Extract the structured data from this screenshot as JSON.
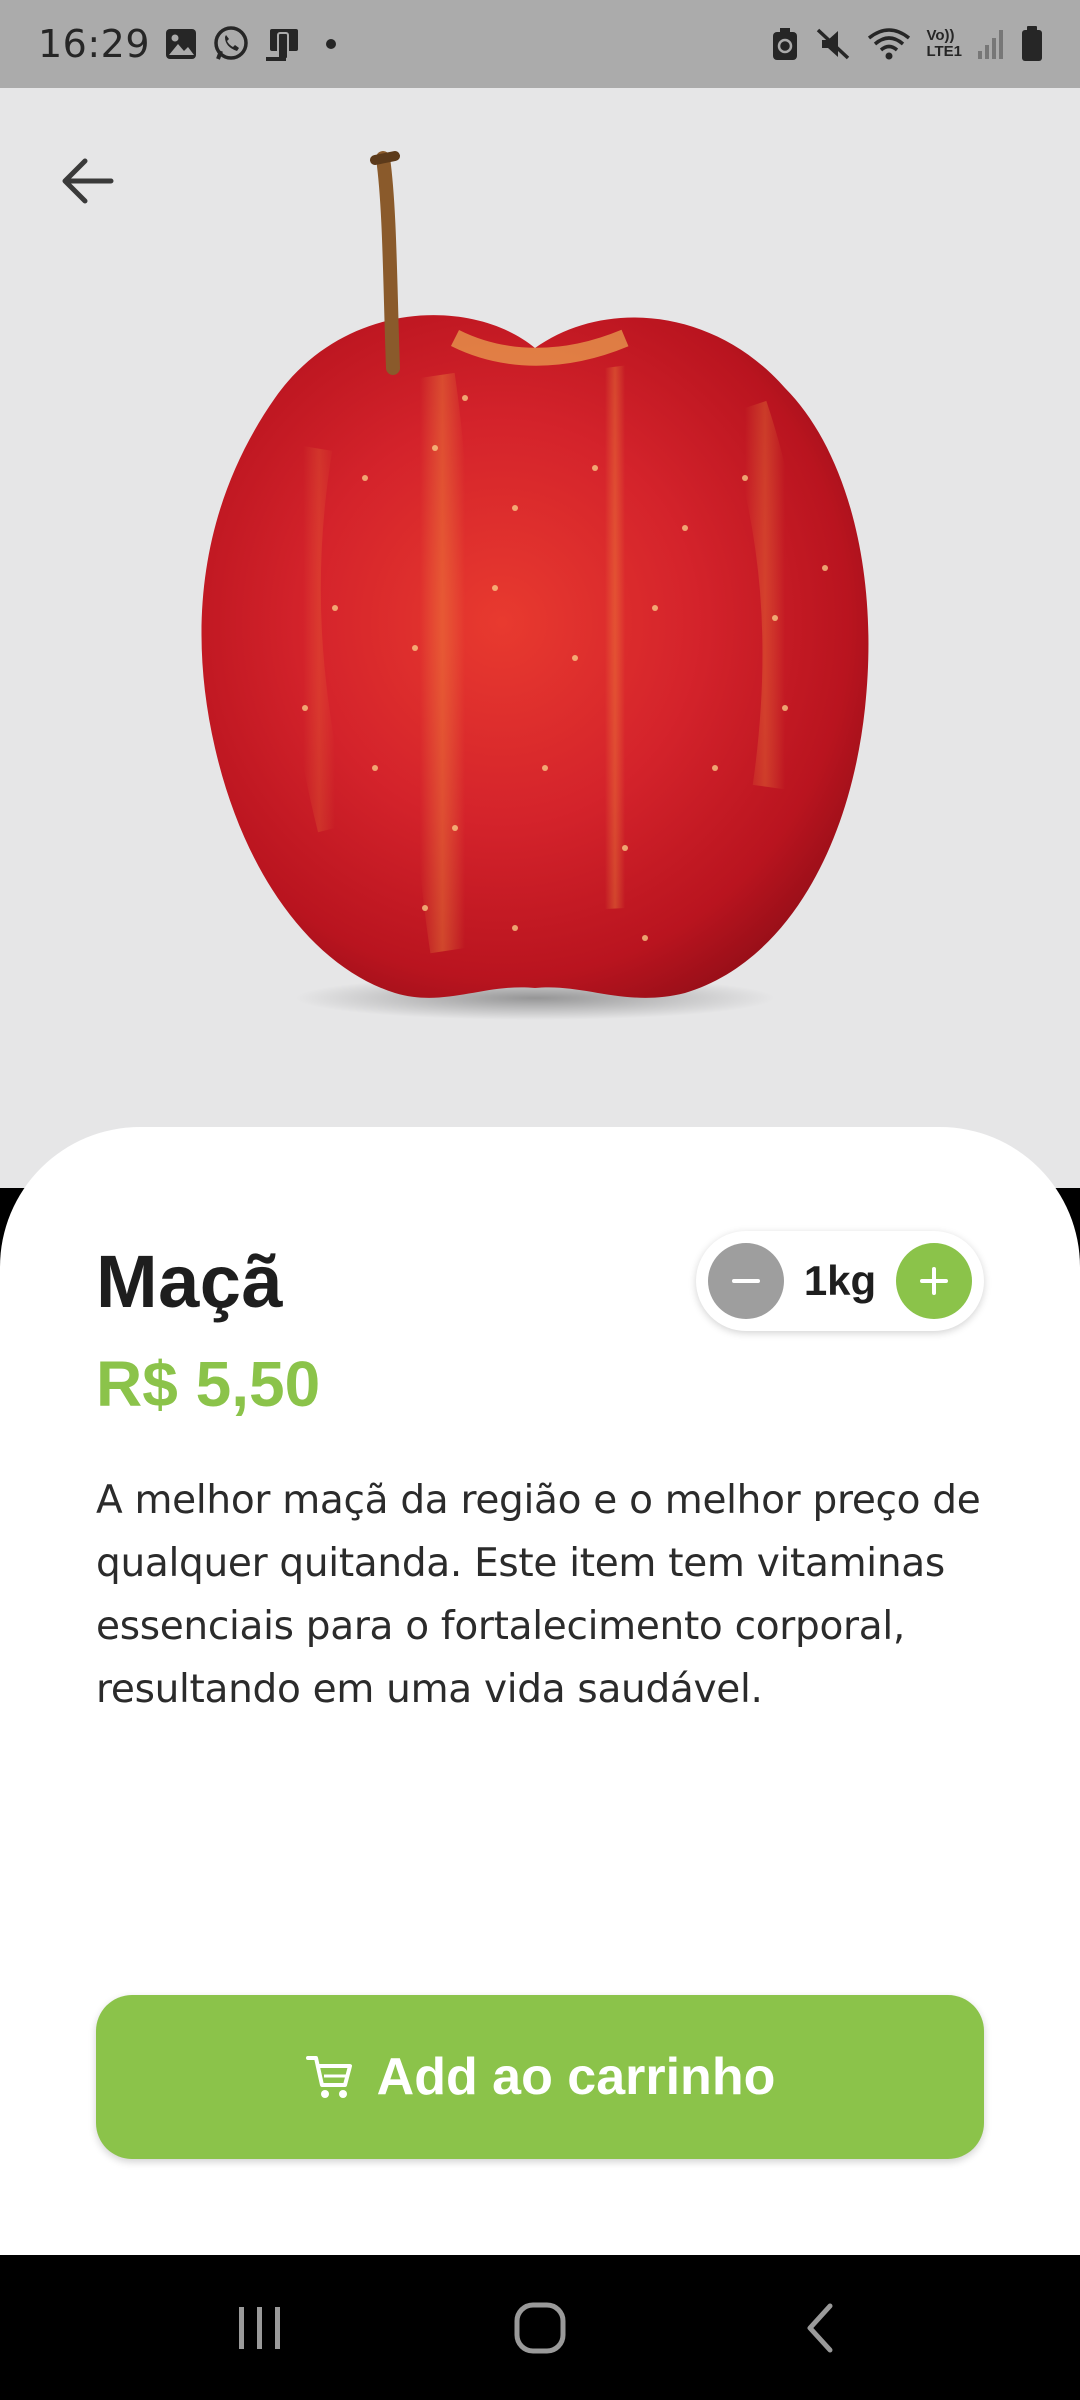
{
  "status_bar": {
    "time": "16:29",
    "left_icons": [
      "image-icon",
      "whatsapp-icon",
      "device-icon"
    ],
    "right_icons": [
      "battery-saver-icon",
      "mute-icon",
      "wifi-icon",
      "volte-icon",
      "signal-icon",
      "battery-icon"
    ],
    "volte_text": "Vo))\nLTE1"
  },
  "hero": {
    "back_icon": "arrow-left-icon",
    "image": "apple-icon"
  },
  "product": {
    "name": "Maçã",
    "price": "R$ 5,50",
    "quantity": "1kg",
    "description": "A melhor maçã da região e o melhor preço de qualquer quitanda. Este item tem vitaminas essenciais para o fortalecimento corporal, resultando em uma vida saudável."
  },
  "actions": {
    "add_to_cart_label": "Add ao carrinho",
    "cart_icon": "cart-icon"
  },
  "colors": {
    "accent": "#8bc34a",
    "minus_button": "#9e9e9e",
    "hero_bg": "#e6e6e7",
    "apple_red": "#d01f2a"
  },
  "nav_bar": {
    "buttons": [
      "recents-icon",
      "home-icon",
      "back-icon"
    ]
  }
}
